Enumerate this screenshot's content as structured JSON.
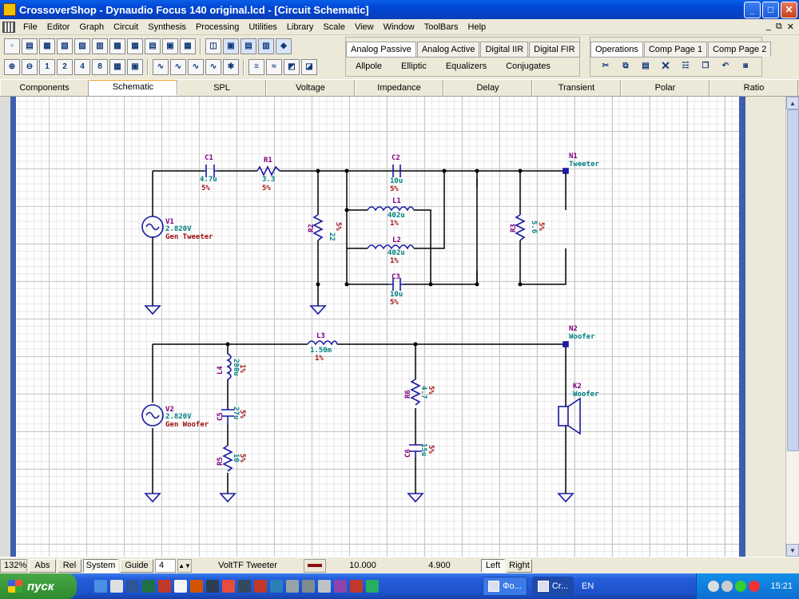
{
  "window": {
    "title": "CrossoverShop - Dynaudio Focus 140 original.lcd - [Circuit Schematic]",
    "min": "_",
    "max": "□",
    "close": "✕"
  },
  "menu": {
    "items": [
      "File",
      "Editor",
      "Graph",
      "Circuit",
      "Synthesis",
      "Processing",
      "Utilities",
      "Library",
      "Scale",
      "View",
      "Window",
      "ToolBars",
      "Help"
    ],
    "mdi_min": "_",
    "mdi_restore": "⧉",
    "mdi_close": "✕"
  },
  "toolbar": {
    "row1_icons": [
      "new-file-icon",
      "open-file-icon",
      "save-icon",
      "save-as-icon",
      "print-icon",
      "copy-graph-icon",
      "export-icon",
      "table-icon",
      "delete-icon",
      "paste-icon",
      "grid-icon",
      "measure-icon",
      "component-library-icon",
      "wire-icon",
      "edit-icon",
      "place-icon",
      "run-icon"
    ],
    "row2_icons": [
      "zoom-in-icon",
      "zoom-out-icon",
      "zoom-1x-icon",
      "zoom-2x-icon",
      "zoom-4x-icon",
      "zoom-8x-icon",
      "zoom-fit-icon",
      "zoom-window-icon",
      "graph-a-icon",
      "graph-b-icon",
      "graph-c-icon",
      "graph-d-icon",
      "graph-e-icon",
      "list-icon",
      "curve-icon",
      "image-icon",
      "color-icon"
    ]
  },
  "filter_tabs": {
    "tabs": [
      "Analog Passive",
      "Analog Active",
      "Digital IIR",
      "Digital FIR"
    ],
    "active": "Analog Passive",
    "sub": [
      "Allpole",
      "Elliptic",
      "Equalizers",
      "Conjugates"
    ]
  },
  "operations_tabs": {
    "tabs": [
      "Operations",
      "Comp Page 1",
      "Comp Page 2"
    ],
    "active": "Operations",
    "icons": [
      "cut-icon",
      "copy-icon",
      "paste-icon",
      "delete-icon",
      "properties-icon",
      "clone-icon",
      "undo-icon",
      "redo-icon"
    ]
  },
  "page_tabs": {
    "items": [
      "Components",
      "Schematic",
      "SPL",
      "Voltage",
      "Impedance",
      "Delay",
      "Transient",
      "Polar",
      "Ratio"
    ],
    "active": "Schematic"
  },
  "schematic": {
    "c1": {
      "name": "C1",
      "value": "4.7u",
      "tol": "5%"
    },
    "r1": {
      "name": "R1",
      "value": "3.3",
      "tol": "5%"
    },
    "c2": {
      "name": "C2",
      "value": "10u",
      "tol": "5%"
    },
    "l1": {
      "name": "L1",
      "value": "402u",
      "tol": "1%"
    },
    "l2": {
      "name": "L2",
      "value": "402u",
      "tol": "1%"
    },
    "c3": {
      "name": "C3",
      "value": "10u",
      "tol": "5%"
    },
    "r2": {
      "name": "R2",
      "value": "22",
      "tol": "5%"
    },
    "r3": {
      "name": "R3",
      "value": "5.6",
      "tol": "5%"
    },
    "v1": {
      "name": "V1",
      "value": "2.820V",
      "label": "Gen Tweeter"
    },
    "n1": {
      "name": "N1",
      "label": "Tweeter"
    },
    "v2": {
      "name": "V2",
      "value": "2.820V",
      "label": "Gen Woofer"
    },
    "l3": {
      "name": "L3",
      "value": "1.50m",
      "tol": "1%"
    },
    "l4": {
      "name": "L4",
      "value": "280u",
      "tol": "1%"
    },
    "c5": {
      "name": "C5",
      "value": "27u",
      "tol": "5%"
    },
    "r5": {
      "name": "R5",
      "value": "10",
      "tol": "5%"
    },
    "r6": {
      "name": "R6",
      "value": "4.7",
      "tol": "5%"
    },
    "c6": {
      "name": "C6",
      "value": "15u",
      "tol": "5%"
    },
    "n2": {
      "name": "N2",
      "label": "Woofer"
    },
    "k2": {
      "name": "K2",
      "label": "Woofer"
    }
  },
  "status": {
    "zoom": "132%",
    "abs": "Abs",
    "rel": "Rel",
    "system": "System",
    "guide": "Guide",
    "guide_value": "4",
    "trace": "VoltTF Tweeter",
    "trace_color": "#8b1010",
    "x_value": "10.000",
    "y_value": "4.900",
    "left": "Left",
    "right": "Right"
  },
  "taskbar": {
    "start": "пуск",
    "tasks": [
      "Фо...",
      "Cr..."
    ],
    "active_task": "Cr...",
    "lang": "EN",
    "clock": "15:21"
  },
  "colors": {
    "wire": "#000000",
    "component": "#1a1aa0",
    "name_label": "#800080",
    "value_label": "#008080",
    "tol_label": "#a01010",
    "node": "#1a1aa0"
  }
}
